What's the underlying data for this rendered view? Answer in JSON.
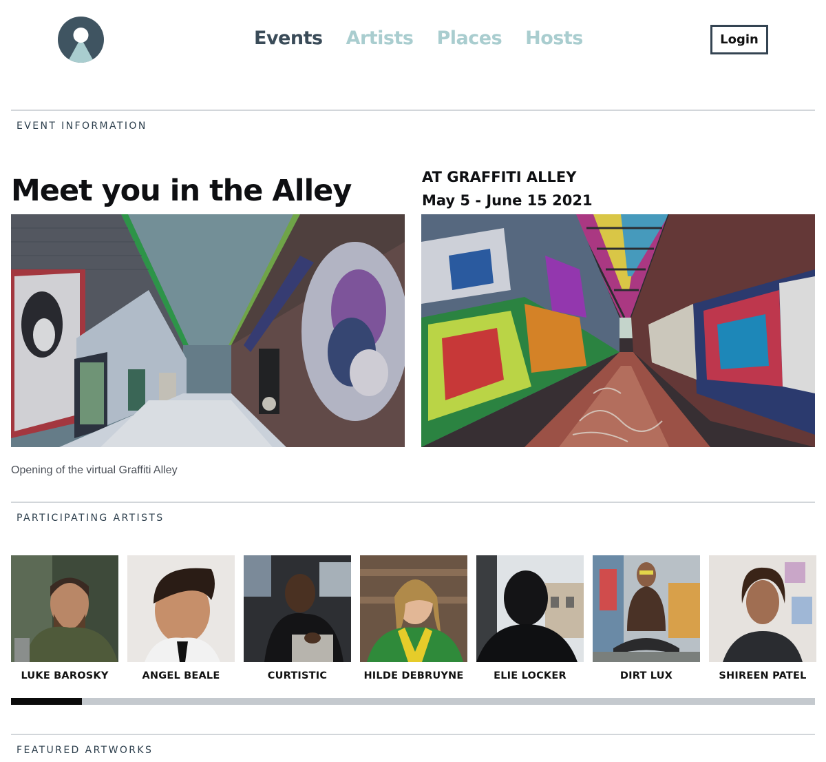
{
  "nav": {
    "items": [
      {
        "label": "Events",
        "active": true
      },
      {
        "label": "Artists",
        "active": false
      },
      {
        "label": "Places",
        "active": false
      },
      {
        "label": "Hosts",
        "active": false
      }
    ],
    "login_label": "Login"
  },
  "colors": {
    "nav_active": "#3a4b58",
    "nav_inactive": "#a9cdcf",
    "logo_circle": "#3f5461",
    "logo_accent": "#a9cdcf"
  },
  "sections": {
    "event_information": "EVENT INFORMATION",
    "participating_artists": "PARTICIPATING ARTISTS",
    "featured_artworks": "FEATURED ARTWORKS"
  },
  "event": {
    "title": "Meet you in the Alley",
    "venue": "AT GRAFFITI ALLEY",
    "dates": "May 5 - June 15 2021",
    "caption": "Opening of the virtual Graffiti Alley"
  },
  "artists": [
    {
      "name": "LUKE BAROSKY"
    },
    {
      "name": "ANGEL BEALE"
    },
    {
      "name": "CURTISTIC"
    },
    {
      "name": "HILDE DEBRUYNE"
    },
    {
      "name": "ELIE LOCKER"
    },
    {
      "name": "DIRT LUX"
    },
    {
      "name": "SHIREEN PATEL"
    }
  ],
  "artist_carousel": {
    "scroll_position_fraction": 0.09
  }
}
